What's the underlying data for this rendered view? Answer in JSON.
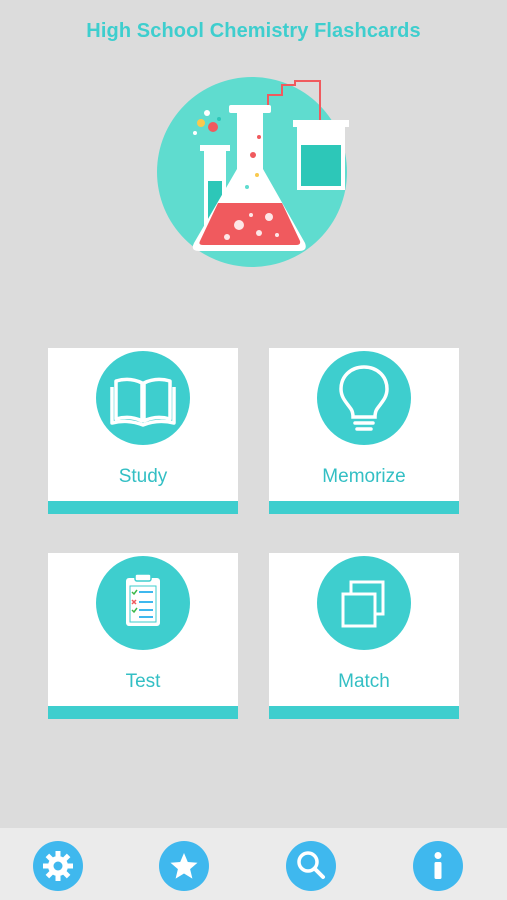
{
  "header": {
    "title": "High School Chemistry Flashcards"
  },
  "hero": {
    "icon": "chemistry-lab-illustration"
  },
  "menu": {
    "study": {
      "label": "Study",
      "icon": "open-book-icon"
    },
    "memorize": {
      "label": "Memorize",
      "icon": "lightbulb-icon"
    },
    "test": {
      "label": "Test",
      "icon": "clipboard-checklist-icon"
    },
    "match": {
      "label": "Match",
      "icon": "overlapping-squares-icon"
    }
  },
  "tab_bar": {
    "items": [
      {
        "icon": "gear-icon"
      },
      {
        "icon": "star-icon"
      },
      {
        "icon": "search-icon"
      },
      {
        "icon": "info-icon"
      }
    ]
  },
  "colors": {
    "background": "#dcdcdc",
    "accent_teal": "#3ecece",
    "tab_blue": "#3fb8ee",
    "flask_red": "#f05a5e",
    "tab_bar_bg": "#ebebeb"
  }
}
